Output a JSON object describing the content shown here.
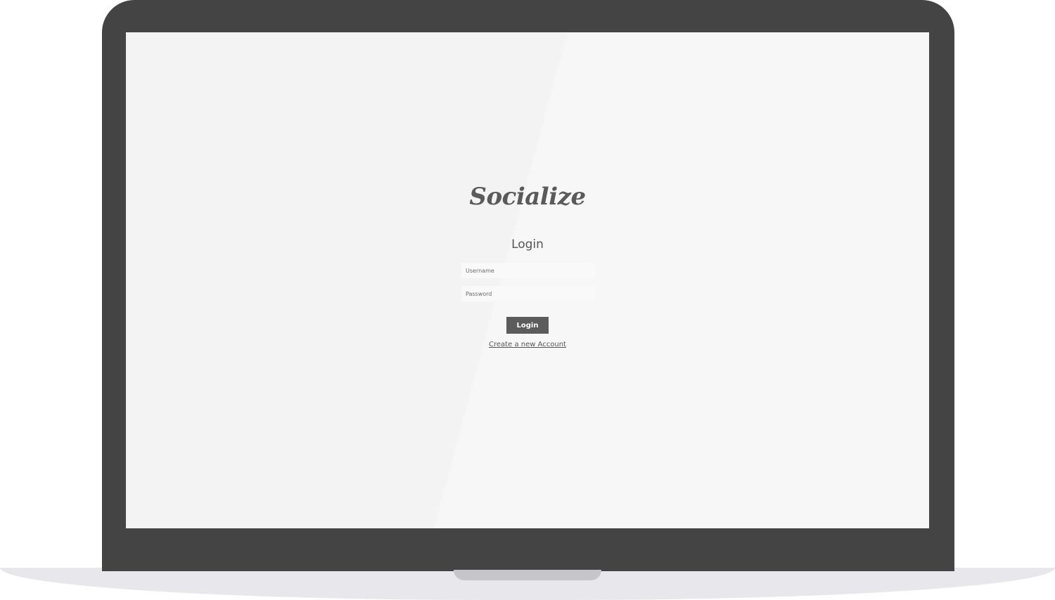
{
  "app": {
    "logo_text": "Socialize"
  },
  "login_form": {
    "title": "Login",
    "username": {
      "placeholder": "Username",
      "value": ""
    },
    "password": {
      "placeholder": "Password",
      "value": ""
    },
    "submit_label": "Login",
    "create_account_link": "Create a new Account"
  },
  "colors": {
    "device_frame": "#444444",
    "screen_background": "#f3f3f3",
    "button_background": "#5c5c5c",
    "text_primary": "#555555"
  }
}
